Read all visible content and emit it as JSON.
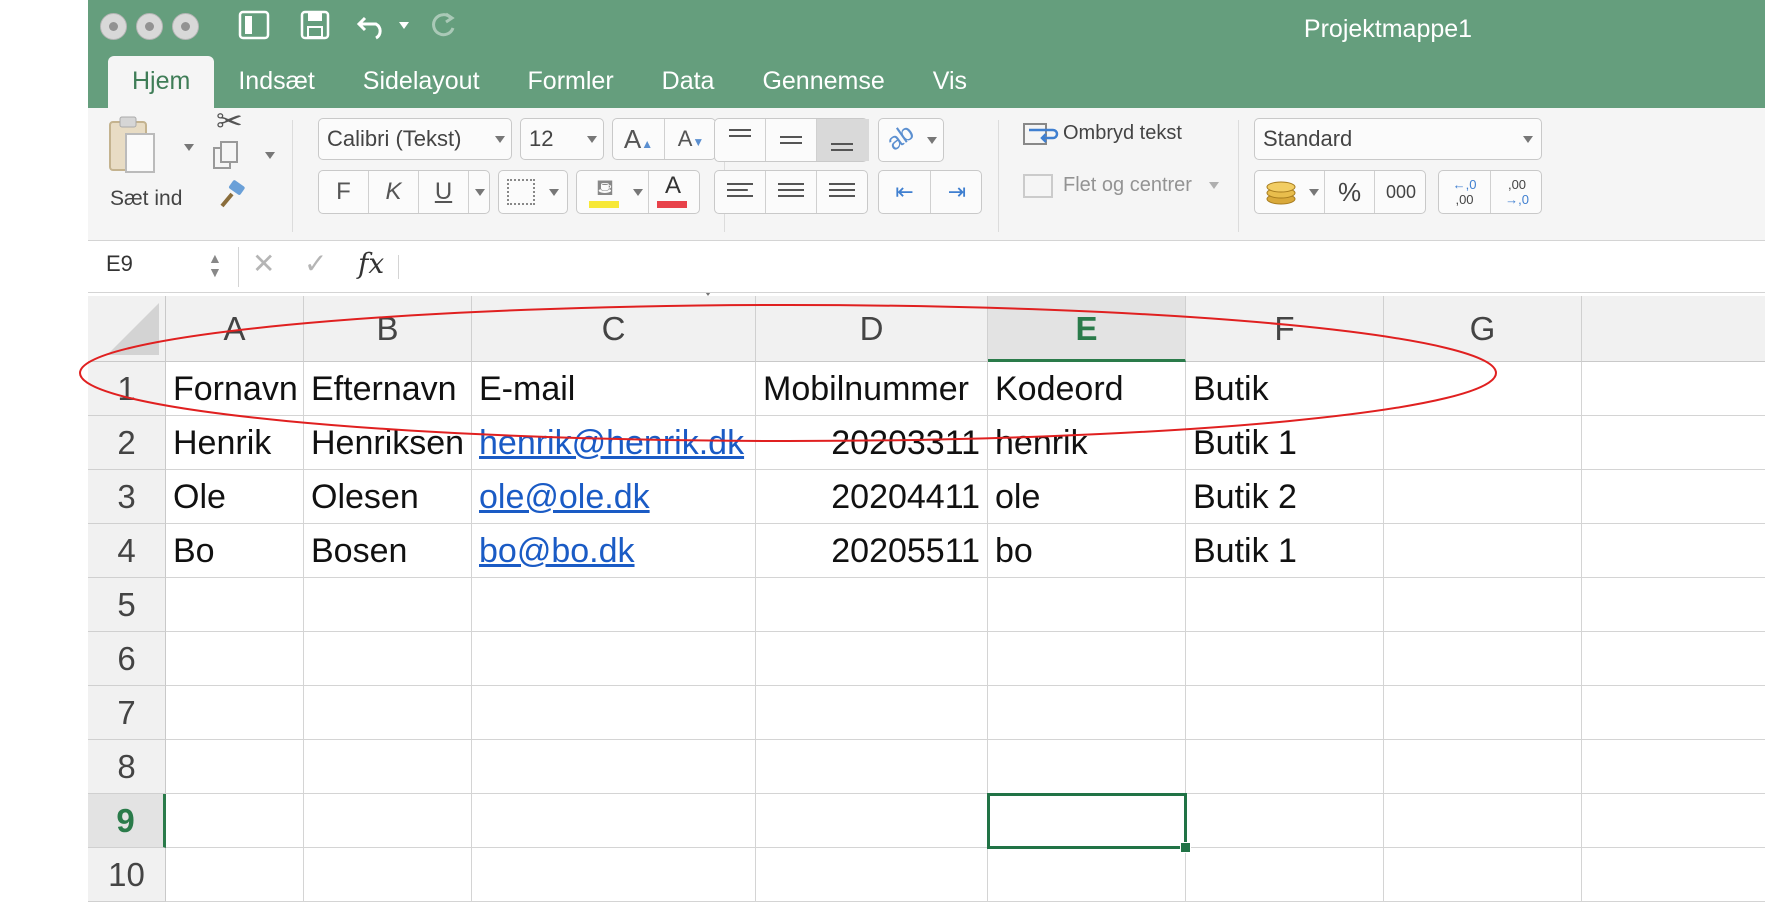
{
  "window": {
    "title": "Projektmappe1"
  },
  "tabs": [
    "Hjem",
    "Indsæt",
    "Sidelayout",
    "Formler",
    "Data",
    "Gennemse",
    "Vis"
  ],
  "ribbon": {
    "paste_label": "Sæt ind",
    "font_name": "Calibri (Tekst)",
    "font_size": "12",
    "bold": "F",
    "italic": "K",
    "underline": "U",
    "grow_font": "A",
    "shrink_font": "A",
    "font_color_glyph": "A",
    "wrap_text": "Ombryd tekst",
    "merge_center": "Flet og centrer",
    "number_format": "Standard",
    "percent": "%",
    "thousands": "000",
    "inc_decimal_top": "←,0",
    "inc_decimal_bottom": ",00",
    "dec_decimal_top": ",00",
    "dec_decimal_bottom": "→,0",
    "highlight_color": "#f7e836",
    "font_color": "#e8424a"
  },
  "formula_bar": {
    "name_box": "E9",
    "fx": "fx",
    "cancel": "✕",
    "enter": "✓"
  },
  "sheet": {
    "columns": [
      "A",
      "B",
      "C",
      "D",
      "E",
      "F",
      "G"
    ],
    "rows": [
      "1",
      "2",
      "3",
      "4",
      "5",
      "6",
      "7",
      "8",
      "9",
      "10"
    ],
    "selected_cell": "E9",
    "data": [
      [
        "Fornavn",
        "Efternavn",
        "E-mail",
        "Mobilnummer",
        "Kodeord",
        "Butik"
      ],
      [
        "Henrik",
        "Henriksen",
        "henrik@henrik.dk",
        "20203311",
        "henrik",
        "Butik 1"
      ],
      [
        "Ole",
        "Olesen",
        "ole@ole.dk",
        "20204411",
        "ole",
        "Butik 2"
      ],
      [
        "Bo",
        "Bosen",
        "bo@bo.dk",
        "20205511",
        "bo",
        "Butik 1"
      ]
    ]
  },
  "colors": {
    "accent": "#217346",
    "titlebar": "#659e7d",
    "annotation": "#e02020",
    "link": "#1a5bc5"
  }
}
